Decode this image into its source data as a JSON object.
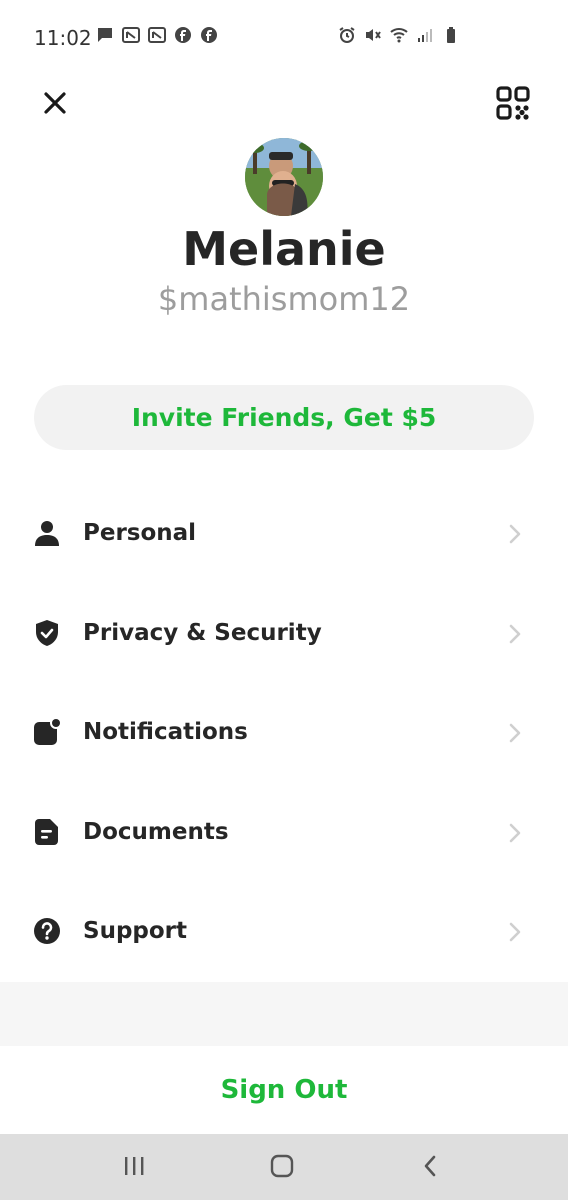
{
  "status_bar": {
    "time": "11:02",
    "left_icons": [
      "message-icon",
      "news-icon",
      "news-icon",
      "facebook-icon",
      "facebook-icon"
    ],
    "right_icons": [
      "alarm-icon",
      "mute-icon",
      "wifi-icon",
      "signal-icon",
      "battery-icon"
    ]
  },
  "profile": {
    "name": "Melanie",
    "handle": "$mathismom12"
  },
  "invite": {
    "label": "Invite Friends, Get $5"
  },
  "menu": {
    "items": [
      {
        "label": "Personal",
        "icon": "person-icon"
      },
      {
        "label": "Privacy & Security",
        "icon": "shield-icon"
      },
      {
        "label": "Notifications",
        "icon": "notification-icon"
      },
      {
        "label": "Documents",
        "icon": "document-icon"
      },
      {
        "label": "Support",
        "icon": "help-icon"
      }
    ]
  },
  "sign_out": {
    "label": "Sign Out"
  },
  "colors": {
    "accent": "#1eb83a",
    "text": "#262626",
    "muted": "#9d9d9d",
    "pill": "#f2f2f2",
    "navbar": "#dedede"
  }
}
